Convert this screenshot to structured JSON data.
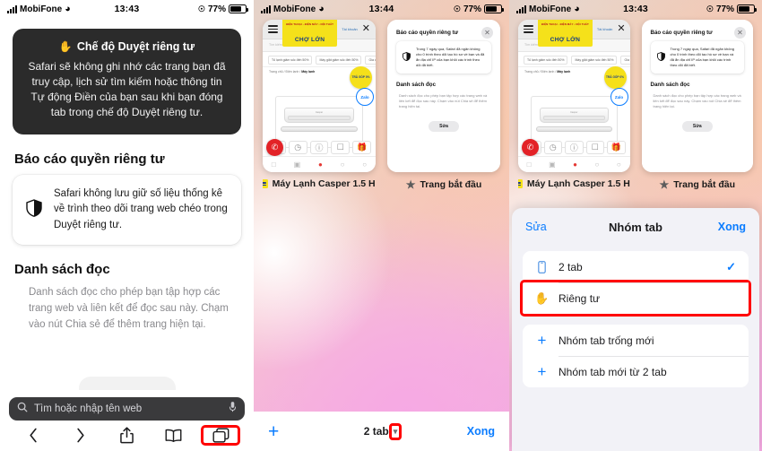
{
  "statusbar": {
    "carrier": "MobiFone",
    "wifi_icon": "wifi-icon",
    "time_p1": "13:43",
    "time_p2": "13:44",
    "time_p3": "13:43",
    "battery_pct": "77%",
    "location_icon": "location-arrow-icon"
  },
  "panel1": {
    "private_card": {
      "hand_icon": "hand-raised-icon",
      "title": "Chế độ Duyệt riêng tư",
      "body": "Safari sẽ không ghi nhớ các trang bạn đã truy cập, lịch sử tìm kiếm hoặc thông tin Tự động Điền của bạn sau khi bạn đóng tab trong chế độ Duyệt riêng tư."
    },
    "privacy_report": {
      "heading": "Báo cáo quyền riêng tư",
      "shield_icon": "shield-half-icon",
      "body": "Safari không lưu giữ số liệu thống kê về trình theo dõi trang web chéo trong Duyệt riêng tư."
    },
    "reading_list": {
      "heading": "Danh sách đọc",
      "body": "Danh sách đọc cho phép bạn tập hợp các trang web và liên kết để đọc sau này. Chạm vào nút Chia sẻ để thêm trang hiện tại."
    },
    "urlbar": {
      "search_icon": "search-icon",
      "placeholder": "Tìm hoặc nhập tên web",
      "mic_icon": "microphone-icon"
    },
    "toolbar": {
      "back": "back-chevron-icon",
      "forward": "forward-chevron-icon",
      "share": "share-icon",
      "bookmarks": "bookmarks-book-icon",
      "tabs": "tabs-icon"
    }
  },
  "tab_switcher": {
    "tabs": [
      {
        "title": "Máy Lạnh Casper 1.5 H...",
        "favicon": "cholon-logo-icon",
        "site": {
          "menu_label": "MENU",
          "logo_top": "ĐIỆN THOẠI - ĐIỆN MÁY  •  NỘI THẤT",
          "logo_main": "CHỢ LỚN",
          "account": "Tài khoản",
          "close_icon": "close-x-icon",
          "search_placeholder": "Tìm kiếm sản phẩm",
          "chips": [
            "Tủ lạnh giảm sốc đến 50%",
            "Máy giặt giảm sốc đến 50%",
            "Gia d"
          ],
          "breadcrumb_pre": "Trang chủ / Điện lạnh /",
          "breadcrumb_cur": "Máy lạnh",
          "product_brand": "Casper",
          "badge_yellow": "TRẢ GÓP 0%",
          "badge_zalo": "Zalo"
        }
      },
      {
        "title": "Trang bắt đầu",
        "favicon": "star-icon",
        "startpage": {
          "close_icon": "close-x-icon",
          "privacy_heading": "Báo cáo quyền riêng tư",
          "shield_icon": "shield-half-icon",
          "privacy_body": "Trong 7 ngày qua, Safari đã ngăn không cho 0 trình theo dõi tạo hồ sơ về bạn và đã ẩn địa chỉ IP của bạn khỏi các trình theo dõi đã biết.",
          "reading_heading": "Danh sách đọc",
          "reading_body": "Danh sách đọc cho phép bạn tập hợp các trang web và liên kết để đọc sau này. Chạm vào nút Chia sẻ để thêm trang hiện tại.",
          "edit_button": "Sửa"
        }
      }
    ],
    "bottombar": {
      "new_tab_icon": "plus-icon",
      "count_label": "2 tab",
      "chevron_icon": "chevron-down-icon",
      "done_label": "Xong"
    }
  },
  "tab_group_sheet": {
    "edit_label": "Sửa",
    "title": "Nhóm tab",
    "done_label": "Xong",
    "groups": [
      {
        "rows": [
          {
            "icon": "iphone-icon",
            "label": "2 tab",
            "checked": "✓",
            "highlighted": false
          },
          {
            "icon": "hand-raised-icon",
            "label": "Riêng tư",
            "checked": "",
            "highlighted": true
          }
        ]
      },
      {
        "rows": [
          {
            "icon": "plus-icon",
            "label": "Nhóm tab trống mới",
            "checked": "",
            "highlighted": false
          },
          {
            "icon": "plus-icon",
            "label": "Nhóm tab mới từ 2 tab",
            "checked": "",
            "highlighted": false
          }
        ]
      }
    ]
  },
  "colors": {
    "accent_blue": "#0a7cff",
    "highlight_red": "#ff0000",
    "dark_card": "#2b2b2b",
    "sheet_bg": "#f2f2f7"
  }
}
